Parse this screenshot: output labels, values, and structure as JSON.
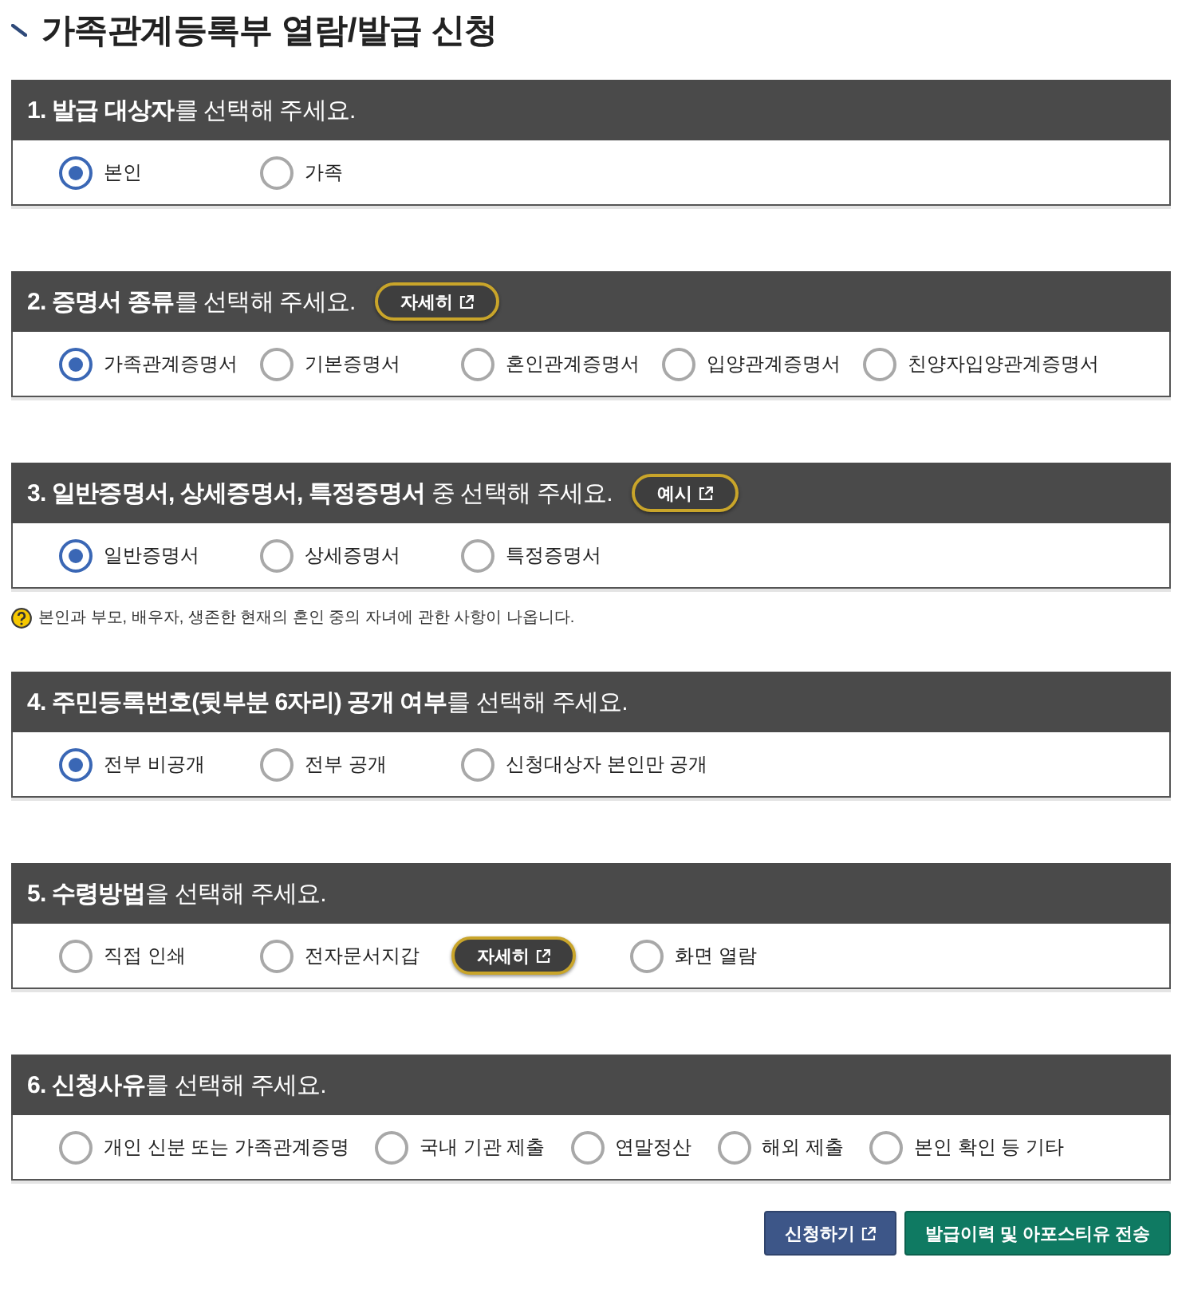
{
  "page": {
    "title": "가족관계등록부 열람/발급 신청"
  },
  "sections": [
    {
      "heading": "**1. 발급 대상자**를 선택해 주세요.",
      "kind": "columns",
      "options": [
        {
          "label": "본인",
          "selected": true
        },
        {
          "label": "가족",
          "selected": false
        }
      ]
    },
    {
      "heading": "**2. 증명서 종류**를 선택해 주세요.",
      "heading_button": {
        "label": "자세히"
      },
      "kind": "columns",
      "options": [
        {
          "label": "가족관계증명서",
          "selected": true
        },
        {
          "label": "기본증명서",
          "selected": false
        },
        {
          "label": "혼인관계증명서",
          "selected": false
        },
        {
          "label": "입양관계증명서",
          "selected": false
        },
        {
          "label": "친양자입양관계증명서",
          "selected": false
        }
      ]
    },
    {
      "heading": "**3. 일반증명서, 상세증명서, 특정증명서** 중 선택해 주세요.",
      "heading_button": {
        "label": "예시"
      },
      "kind": "columns",
      "options": [
        {
          "label": "일반증명서",
          "selected": true
        },
        {
          "label": "상세증명서",
          "selected": false
        },
        {
          "label": "특정증명서",
          "selected": false
        }
      ],
      "note": "본인과 부모, 배우자, 생존한 현재의 혼인 중의 자녀에 관한 사항이 나옵니다."
    },
    {
      "heading": "**4. 주민등록번호(뒷부분 6자리) 공개 여부**를 선택해 주세요.",
      "kind": "columns",
      "options": [
        {
          "label": "전부 비공개",
          "selected": true
        },
        {
          "label": "전부 공개",
          "selected": false
        },
        {
          "label": "신청대상자 본인만 공개",
          "selected": false
        }
      ]
    },
    {
      "heading": "**5. 수령방법**을 선택해 주세요.",
      "kind": "columns",
      "options": [
        {
          "label": "직접 인쇄",
          "selected": false
        },
        {
          "label": "전자문서지갑",
          "selected": false,
          "button": {
            "label": "자세히"
          }
        },
        {
          "label": "화면 열람",
          "selected": false
        }
      ]
    },
    {
      "heading": "**6. 신청사유**를 선택해 주세요.",
      "kind": "flow",
      "options": [
        {
          "label": "개인 신분 또는 가족관계증명",
          "selected": false
        },
        {
          "label": "국내 기관 제출",
          "selected": false
        },
        {
          "label": "연말정산",
          "selected": false
        },
        {
          "label": "해외 제출",
          "selected": false
        },
        {
          "label": "본인 확인 등 기타",
          "selected": false
        }
      ]
    }
  ],
  "actions": [
    {
      "label": "신청하기",
      "kind": "primary",
      "external": true
    },
    {
      "label": "발급이력 및 아포스티유 전송",
      "kind": "secondary",
      "external": false
    }
  ]
}
